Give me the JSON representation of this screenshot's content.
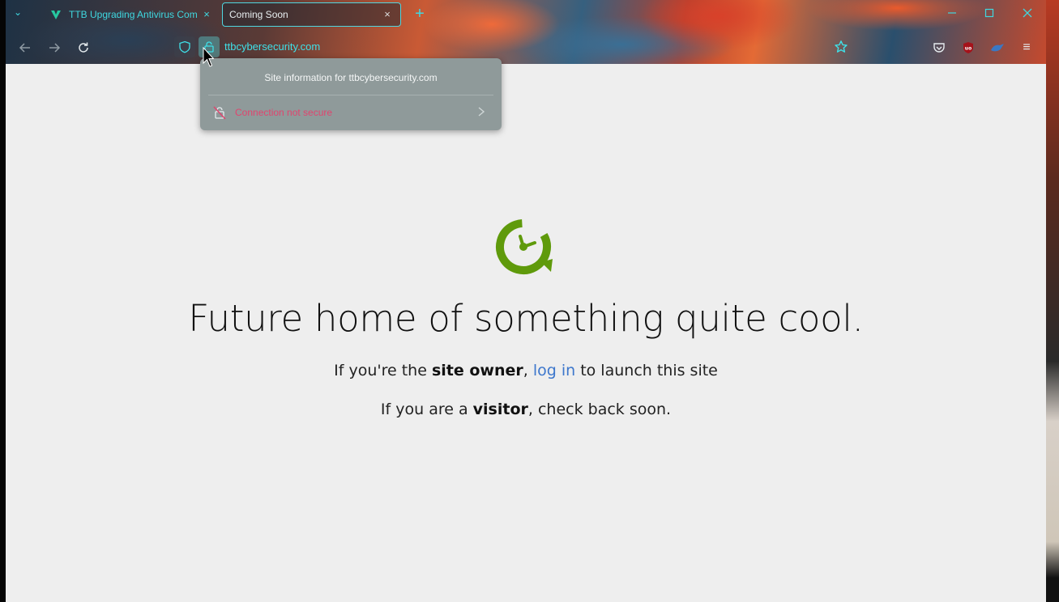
{
  "browser": {
    "tabs": [
      {
        "title": "TTB Upgrading Antivirus Com",
        "favicon": "ttb-favicon-icon",
        "active": false
      },
      {
        "title": "Coming Soon",
        "active": true
      }
    ],
    "new_tab_label": "+",
    "url": "ttbcybersecurity.com",
    "menu_glyph": "≡",
    "accent_color": "#3fe0e8"
  },
  "site_info_popup": {
    "title": "Site information for ttbcybersecurity.com",
    "connection_status": "Connection not secure",
    "status_color": "#e0446e"
  },
  "page": {
    "headline": "Future home of something quite cool.",
    "line1": {
      "prefix": "If you're the ",
      "bold": "site owner",
      "sep": ", ",
      "link": "log in",
      "suffix": " to launch this site"
    },
    "line2": {
      "prefix": "If you are a ",
      "bold": "visitor",
      "suffix": ", check back soon."
    },
    "logo_color": "#5f9a0b"
  }
}
